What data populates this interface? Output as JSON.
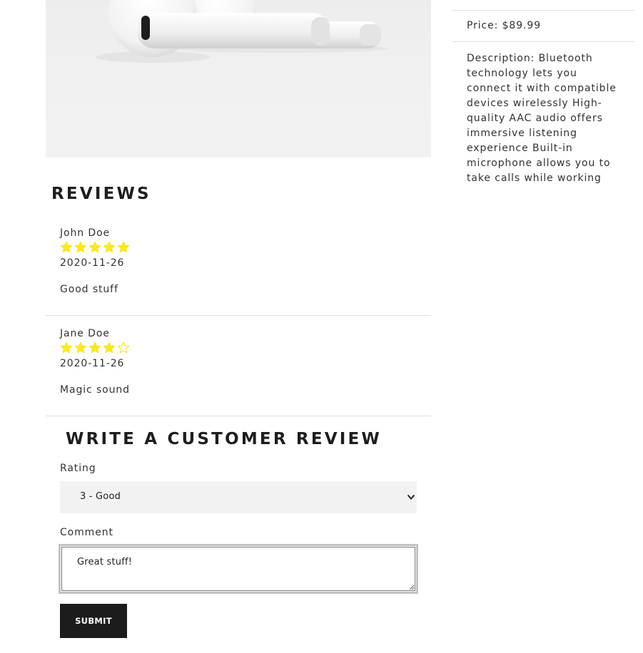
{
  "product": {
    "image_icon": "earbuds-photo",
    "price": "Price: $89.99",
    "description": "Description: Bluetooth technology lets you connect it with compatible devices wirelessly High-quality AAC audio offers immersive listening experience Built-in microphone allows you to take calls while working"
  },
  "reviews": {
    "title": "REVIEWS",
    "items": [
      {
        "name": "John Doe",
        "rating": 5,
        "max_rating": 5,
        "date": "2020-11-26",
        "comment": "Good stuff"
      },
      {
        "name": "Jane Doe",
        "rating": 4,
        "max_rating": 5,
        "date": "2020-11-26",
        "comment": "Magic sound"
      }
    ]
  },
  "form": {
    "title": "WRITE A CUSTOMER REVIEW",
    "rating_label": "Rating",
    "rating_value": "3 - Good",
    "comment_label": "Comment",
    "comment_value": "Great stuff!",
    "submit_label": "SUBMIT"
  },
  "colors": {
    "star": "#f8e825",
    "button": "#1c1c1c",
    "divider": "#dfdfdf"
  }
}
